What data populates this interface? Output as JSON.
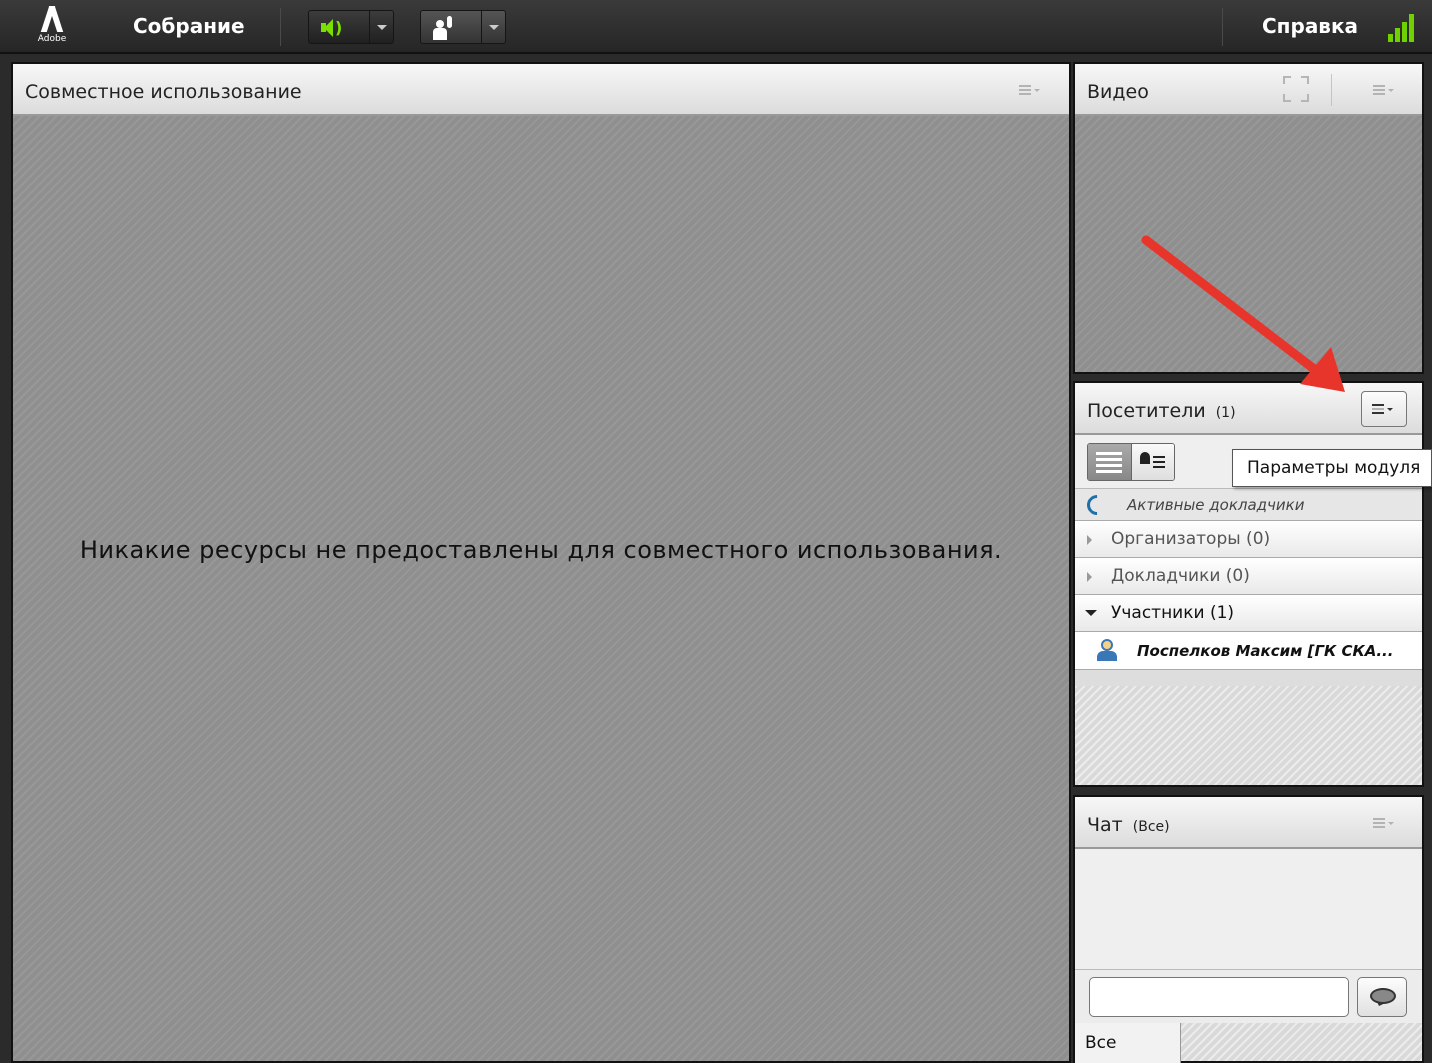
{
  "app": {
    "logo_text": "Adobe",
    "meeting_menu": "Собрание",
    "help_menu": "Справка"
  },
  "toolbar": {
    "audio_icon": "speaker-icon",
    "raise_hand_icon": "raise-hand-icon",
    "connection_icon": "signal-strength-icon",
    "accent_green": "#6fd100"
  },
  "share_pod": {
    "title": "Совместное использование",
    "empty_message": "Никакие ресурсы не предоставлены для совместного использования."
  },
  "video_pod": {
    "title": "Видео"
  },
  "attendees_pod": {
    "title": "Посетители",
    "count": "(1)",
    "tooltip": "Параметры модуля",
    "active_speakers": "Активные докладчики",
    "groups": [
      {
        "label": "Организаторы (0)",
        "expanded": false
      },
      {
        "label": "Докладчики (0)",
        "expanded": false
      },
      {
        "label": "Участники (1)",
        "expanded": true
      }
    ],
    "people": [
      {
        "name": "Поспелков Максим [ГК СКА..."
      }
    ]
  },
  "chat_pod": {
    "title": "Чат",
    "scope": "(Все)",
    "input_value": "",
    "tabs": [
      "Все"
    ]
  },
  "annotation": {
    "arrow_color": "#e8352b"
  }
}
